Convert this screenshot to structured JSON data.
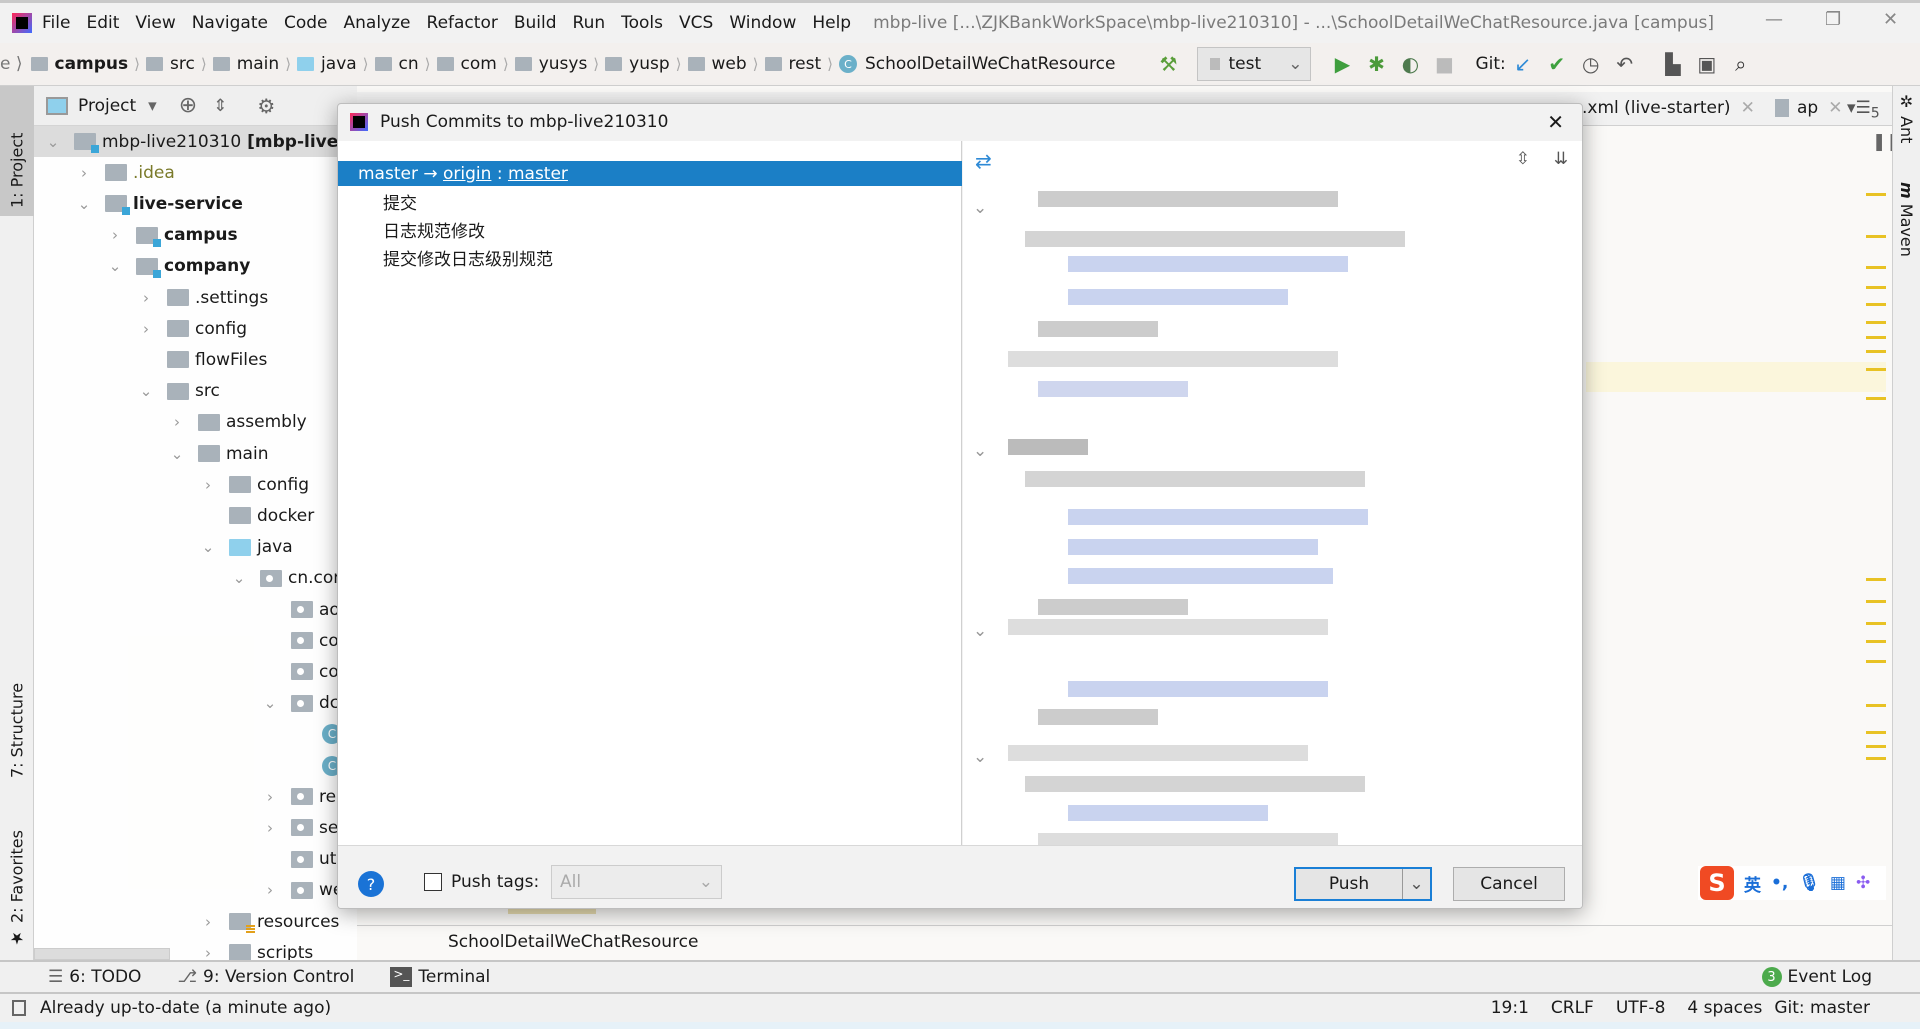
{
  "menubar": {
    "items": [
      "File",
      "Edit",
      "View",
      "Navigate",
      "Code",
      "Analyze",
      "Refactor",
      "Build",
      "Run",
      "Tools",
      "VCS",
      "Window",
      "Help"
    ],
    "window_title": "mbp-live [...\\ZJKBankWorkSpace\\mbp-live210310] - ...\\SchoolDetailWeChatResource.java [campus]"
  },
  "breadcrumb": [
    "campus",
    "src",
    "main",
    "java",
    "cn",
    "com",
    "yusys",
    "yusp",
    "web",
    "rest",
    "SchoolDetailWeChatResource"
  ],
  "toolbar": {
    "run_config": "test",
    "git_label": "Git:"
  },
  "left_stripe": {
    "project": "1: Project",
    "structure": "7: Structure",
    "favorites": "2: Favorites"
  },
  "project_panel": {
    "title": "Project",
    "tree": [
      {
        "name": "mbp-live210310",
        "suffix": "[mbp-live]",
        "level": 0,
        "state": "open",
        "icon": "module"
      },
      {
        "name": ".idea",
        "level": 1,
        "state": "closed",
        "icon": "folder",
        "color": "#7a7a2a"
      },
      {
        "name": "live-service",
        "level": 1,
        "state": "open",
        "icon": "module",
        "bold": true
      },
      {
        "name": "campus",
        "level": 2,
        "state": "closed",
        "icon": "module",
        "bold": true
      },
      {
        "name": "company",
        "level": 2,
        "state": "open",
        "icon": "module",
        "bold": true
      },
      {
        "name": ".settings",
        "level": 3,
        "state": "closed",
        "icon": "folder"
      },
      {
        "name": "config",
        "level": 3,
        "state": "closed",
        "icon": "folder"
      },
      {
        "name": "flowFiles",
        "level": 3,
        "state": "none",
        "icon": "folder"
      },
      {
        "name": "src",
        "level": 3,
        "state": "open",
        "icon": "folder"
      },
      {
        "name": "assembly",
        "level": 4,
        "state": "closed",
        "icon": "folder"
      },
      {
        "name": "main",
        "level": 4,
        "state": "open",
        "icon": "folder"
      },
      {
        "name": "config",
        "level": 5,
        "state": "closed",
        "icon": "folder"
      },
      {
        "name": "docker",
        "level": 5,
        "state": "none",
        "icon": "folder"
      },
      {
        "name": "java",
        "level": 5,
        "state": "open",
        "icon": "source"
      },
      {
        "name": "cn.cor",
        "level": 6,
        "state": "open",
        "icon": "package"
      },
      {
        "name": "ao",
        "level": 7,
        "state": "none",
        "icon": "package"
      },
      {
        "name": "co",
        "level": 7,
        "state": "none",
        "icon": "package"
      },
      {
        "name": "co",
        "level": 7,
        "state": "none",
        "icon": "package"
      },
      {
        "name": "dc",
        "level": 7,
        "state": "open",
        "icon": "package"
      },
      {
        "name": "",
        "level": 8,
        "state": "none",
        "icon": "class"
      },
      {
        "name": "",
        "level": 8,
        "state": "none",
        "icon": "class"
      },
      {
        "name": "rep",
        "level": 7,
        "state": "closed",
        "icon": "package"
      },
      {
        "name": "se",
        "level": 7,
        "state": "closed",
        "icon": "package"
      },
      {
        "name": "uti",
        "level": 7,
        "state": "none",
        "icon": "package"
      },
      {
        "name": "we",
        "level": 7,
        "state": "closed",
        "icon": "package"
      },
      {
        "name": "resources",
        "level": 5,
        "state": "closed",
        "icon": "resources"
      },
      {
        "name": "scripts",
        "level": 5,
        "state": "closed",
        "icon": "folder"
      }
    ]
  },
  "editor": {
    "tabs": [
      ".xml (live-starter)",
      "ap"
    ],
    "tab_count": "5",
    "breadcrumb": "SchoolDetailWeChatResource"
  },
  "right_stripe": {
    "ant": "Ant",
    "maven": "Maven"
  },
  "dialog": {
    "title": "Push Commits to mbp-live210310",
    "branch": {
      "local": "master",
      "arrow": "→",
      "remote": "origin",
      "sep": ":",
      "remote_branch": "master"
    },
    "commits": [
      "提交",
      "日志规范修改",
      "提交修改日志级别规范"
    ],
    "push_tags_label": "Push tags:",
    "push_tags_checked": false,
    "push_tags_value": "All",
    "push_label": "Push",
    "cancel_label": "Cancel"
  },
  "bottom_tools": {
    "todo": "6: TODO",
    "vcs": "9: Version Control",
    "terminal": "Terminal",
    "event_log": "Event Log",
    "event_count": "3"
  },
  "statusbar": {
    "message": "Already up-to-date (a minute ago)",
    "position": "19:1",
    "line_sep": "CRLF",
    "encoding": "UTF-8",
    "indent": "4 spaces",
    "git": "Git: master"
  },
  "ime": {
    "lang": "英"
  },
  "colors": {
    "selection": "#1b7fc6",
    "accent": "#3ba6d8"
  }
}
